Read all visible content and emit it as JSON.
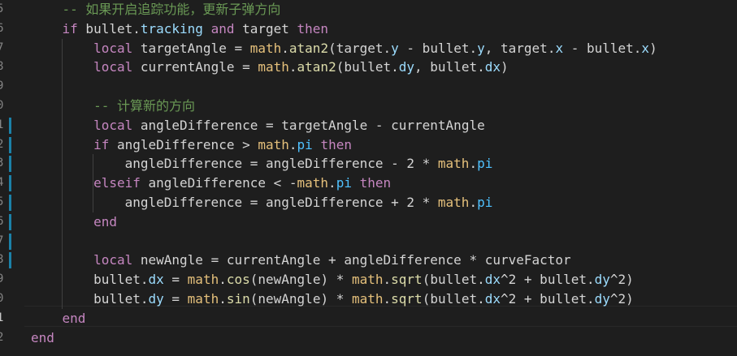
{
  "editor": {
    "line_numbers": [
      "5",
      "6",
      "7",
      "8",
      "9",
      "0",
      "1",
      "2",
      "3",
      "4",
      "5",
      "6",
      "7",
      "8",
      "9",
      "0",
      "1",
      "2"
    ],
    "active_line_number": "1",
    "lines": [
      [
        {
          "t": "    "
        },
        {
          "c": "com",
          "t": "-- 如果开启追踪功能，更新子弹方向"
        }
      ],
      [
        {
          "t": "    "
        },
        {
          "c": "kw",
          "t": "if"
        },
        {
          "t": " bullet."
        },
        {
          "c": "prop",
          "t": "tracking"
        },
        {
          "t": " "
        },
        {
          "c": "kw",
          "t": "and"
        },
        {
          "t": " target "
        },
        {
          "c": "kw",
          "t": "then"
        }
      ],
      [
        {
          "t": "        "
        },
        {
          "c": "kw",
          "t": "local"
        },
        {
          "t": " targetAngle = "
        },
        {
          "c": "mathlib",
          "t": "math"
        },
        {
          "t": "."
        },
        {
          "c": "fn",
          "t": "atan2"
        },
        {
          "t": "(target."
        },
        {
          "c": "prop",
          "t": "y"
        },
        {
          "t": " - bullet."
        },
        {
          "c": "prop",
          "t": "y"
        },
        {
          "t": ", target."
        },
        {
          "c": "prop",
          "t": "x"
        },
        {
          "t": " - bullet."
        },
        {
          "c": "prop",
          "t": "x"
        },
        {
          "t": ")"
        }
      ],
      [
        {
          "t": "        "
        },
        {
          "c": "kw",
          "t": "local"
        },
        {
          "t": " currentAngle = "
        },
        {
          "c": "mathlib",
          "t": "math"
        },
        {
          "t": "."
        },
        {
          "c": "fn",
          "t": "atan2"
        },
        {
          "t": "(bullet."
        },
        {
          "c": "prop",
          "t": "dy"
        },
        {
          "t": ", bullet."
        },
        {
          "c": "prop",
          "t": "dx"
        },
        {
          "t": ")"
        }
      ],
      [],
      [
        {
          "t": "        "
        },
        {
          "c": "com",
          "t": "-- 计算新的方向"
        }
      ],
      [
        {
          "t": "        "
        },
        {
          "c": "kw",
          "t": "local"
        },
        {
          "t": " angleDifference = targetAngle - currentAngle"
        }
      ],
      [
        {
          "t": "        "
        },
        {
          "c": "kw",
          "t": "if"
        },
        {
          "t": " angleDifference > "
        },
        {
          "c": "mathlib",
          "t": "math"
        },
        {
          "t": "."
        },
        {
          "c": "const",
          "t": "pi"
        },
        {
          "t": " "
        },
        {
          "c": "kw",
          "t": "then"
        }
      ],
      [
        {
          "t": "            angleDifference = angleDifference - 2 * "
        },
        {
          "c": "mathlib",
          "t": "math"
        },
        {
          "t": "."
        },
        {
          "c": "const",
          "t": "pi"
        }
      ],
      [
        {
          "t": "        "
        },
        {
          "c": "kw",
          "t": "elseif"
        },
        {
          "t": " angleDifference < -"
        },
        {
          "c": "mathlib",
          "t": "math"
        },
        {
          "t": "."
        },
        {
          "c": "const",
          "t": "pi"
        },
        {
          "t": " "
        },
        {
          "c": "kw",
          "t": "then"
        }
      ],
      [
        {
          "t": "            angleDifference = angleDifference + 2 * "
        },
        {
          "c": "mathlib",
          "t": "math"
        },
        {
          "t": "."
        },
        {
          "c": "const",
          "t": "pi"
        }
      ],
      [
        {
          "t": "        "
        },
        {
          "c": "kw",
          "t": "end"
        }
      ],
      [],
      [
        {
          "t": "        "
        },
        {
          "c": "kw",
          "t": "local"
        },
        {
          "t": " newAngle = currentAngle + angleDifference * curveFactor"
        }
      ],
      [
        {
          "t": "        bullet."
        },
        {
          "c": "prop",
          "t": "dx"
        },
        {
          "t": " = "
        },
        {
          "c": "mathlib",
          "t": "math"
        },
        {
          "t": "."
        },
        {
          "c": "fn",
          "t": "cos"
        },
        {
          "t": "(newAngle) * "
        },
        {
          "c": "mathlib",
          "t": "math"
        },
        {
          "t": "."
        },
        {
          "c": "fn",
          "t": "sqrt"
        },
        {
          "t": "(bullet."
        },
        {
          "c": "prop",
          "t": "dx"
        },
        {
          "t": "^2 + bullet."
        },
        {
          "c": "prop",
          "t": "dy"
        },
        {
          "t": "^2)"
        }
      ],
      [
        {
          "t": "        bullet."
        },
        {
          "c": "prop",
          "t": "dy"
        },
        {
          "t": " = "
        },
        {
          "c": "mathlib",
          "t": "math"
        },
        {
          "t": "."
        },
        {
          "c": "fn",
          "t": "sin"
        },
        {
          "t": "(newAngle) * "
        },
        {
          "c": "mathlib",
          "t": "math"
        },
        {
          "t": "."
        },
        {
          "c": "fn",
          "t": "sqrt"
        },
        {
          "t": "(bullet."
        },
        {
          "c": "prop",
          "t": "dx"
        },
        {
          "t": "^2 + bullet."
        },
        {
          "c": "prop",
          "t": "dy"
        },
        {
          "t": "^2)"
        }
      ],
      [
        {
          "t": "    "
        },
        {
          "c": "kw",
          "t": "end"
        }
      ],
      [
        {
          "c": "kw",
          "t": "end"
        }
      ]
    ]
  },
  "colors": {
    "background": "#1e1e1e",
    "comment": "#6a9955",
    "keyword": "#c586c0",
    "default": "#d4d4d4",
    "property": "#9cdcfe",
    "function": "#dcdcaa",
    "math_lib": "#e5c07b",
    "constant": "#4fc1ff",
    "modified_gutter": "#1b81a8"
  }
}
